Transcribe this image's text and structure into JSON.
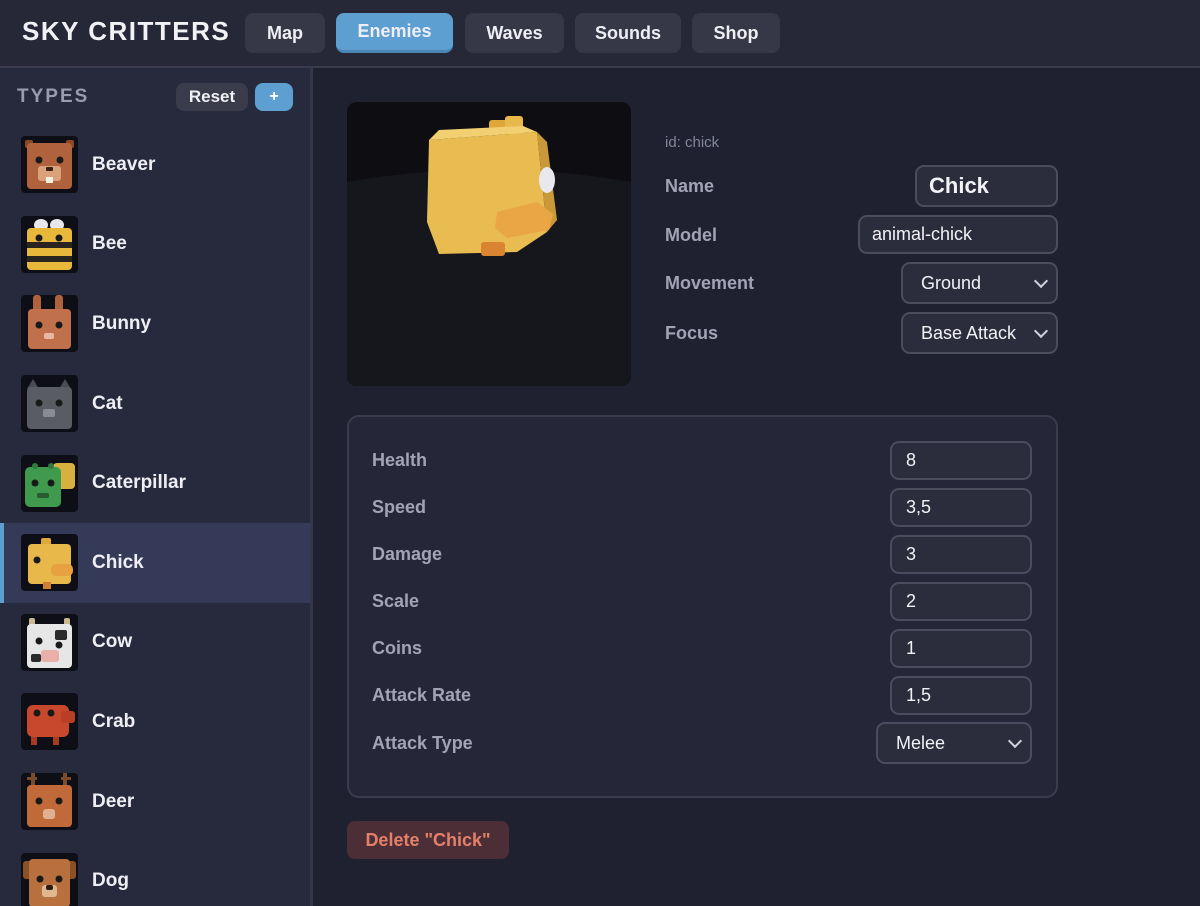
{
  "app": {
    "title": "SKY CRITTERS"
  },
  "nav": {
    "tabs": [
      {
        "label": "Map"
      },
      {
        "label": "Enemies",
        "active": true
      },
      {
        "label": "Waves"
      },
      {
        "label": "Sounds"
      },
      {
        "label": "Shop"
      }
    ]
  },
  "sidebar": {
    "heading": "TYPES",
    "reset_label": "Reset",
    "add_label": "+",
    "items": [
      {
        "label": "Beaver",
        "color": "#b0623c",
        "icon": "beaver-icon"
      },
      {
        "label": "Bee",
        "color": "#e8b83a",
        "icon": "bee-icon"
      },
      {
        "label": "Bunny",
        "color": "#c0704a",
        "icon": "bunny-icon"
      },
      {
        "label": "Cat",
        "color": "#5a5c64",
        "icon": "cat-icon"
      },
      {
        "label": "Caterpillar",
        "color": "#3f9a4e",
        "icon": "caterpillar-icon"
      },
      {
        "label": "Chick",
        "color": "#e8b84a",
        "icon": "chick-icon",
        "selected": true
      },
      {
        "label": "Cow",
        "color": "#e6e6e6",
        "icon": "cow-icon"
      },
      {
        "label": "Crab",
        "color": "#c8482e",
        "icon": "crab-icon"
      },
      {
        "label": "Deer",
        "color": "#c06a3a",
        "icon": "deer-icon"
      },
      {
        "label": "Dog",
        "color": "#b8703e",
        "icon": "dog-icon"
      }
    ]
  },
  "detail": {
    "id_text": "id: chick",
    "name_label": "Name",
    "name_value": "Chick",
    "model_label": "Model",
    "model_value": "animal-chick",
    "movement_label": "Movement",
    "movement_value": "Ground",
    "focus_label": "Focus",
    "focus_value": "Base Attack"
  },
  "stats": {
    "health": {
      "label": "Health",
      "value": "8"
    },
    "speed": {
      "label": "Speed",
      "value": "3,5"
    },
    "damage": {
      "label": "Damage",
      "value": "3"
    },
    "scale": {
      "label": "Scale",
      "value": "2"
    },
    "coins": {
      "label": "Coins",
      "value": "1"
    },
    "attack_rate": {
      "label": "Attack Rate",
      "value": "1,5"
    },
    "attack_type": {
      "label": "Attack Type",
      "value": "Melee"
    }
  },
  "delete_label": "Delete \"Chick\"",
  "colors": {
    "accent": "#5e9fd2",
    "background": "#1f2030",
    "danger_text": "#e4806a"
  }
}
